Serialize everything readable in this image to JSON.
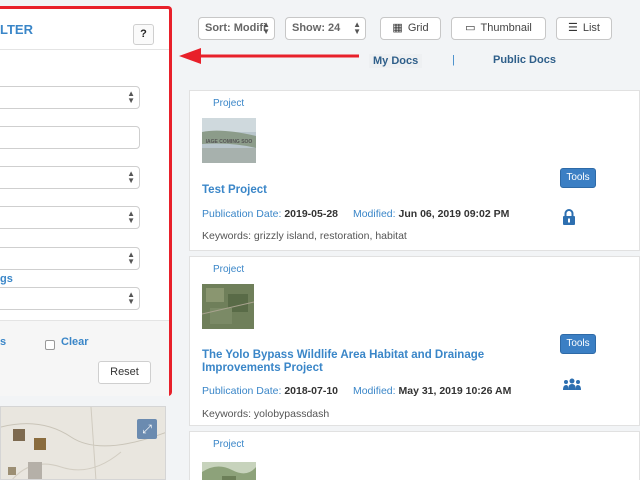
{
  "filter": {
    "title": "LTER",
    "help_label": "?",
    "tags_label": "gs",
    "footer_left_label": "s",
    "clear_label": "Clear",
    "reset_label": "Reset"
  },
  "toolbar": {
    "sort_label": "Sort: Modifi",
    "show_label": "Show: 24",
    "grid_label": "Grid",
    "thumbnail_label": "Thumbnail",
    "list_label": "List"
  },
  "tabs": {
    "my_docs": "My Docs",
    "separator": "|",
    "public_docs": "Public Docs"
  },
  "map": {
    "expand_icon": "expand-icon"
  },
  "results": [
    {
      "type": "Project",
      "thumb_caption": "IAGE COMING SOO",
      "title": "Test Project",
      "pub_label": "Publication Date:",
      "pub_date": "2019-05-28",
      "mod_label": "Modified:",
      "mod_date": "Jun 06, 2019 09:02 PM",
      "keywords": "Keywords: grizzly island, restoration, habitat",
      "tools_label": "Tools",
      "status_icon": "lock-icon"
    },
    {
      "type": "Project",
      "title": "The Yolo Bypass Wildlife Area Habitat and Drainage Improvements Project",
      "pub_label": "Publication Date:",
      "pub_date": "2018-07-10",
      "mod_label": "Modified:",
      "mod_date": "May 31, 2019 10:26 AM",
      "keywords": "Keywords: yolobypassdash",
      "tools_label": "Tools",
      "status_icon": "group-icon"
    },
    {
      "type": "Project"
    }
  ],
  "colors": {
    "accent": "#3a86c8",
    "annotation": "#e8202a",
    "tools_button": "#3b7fc4"
  }
}
